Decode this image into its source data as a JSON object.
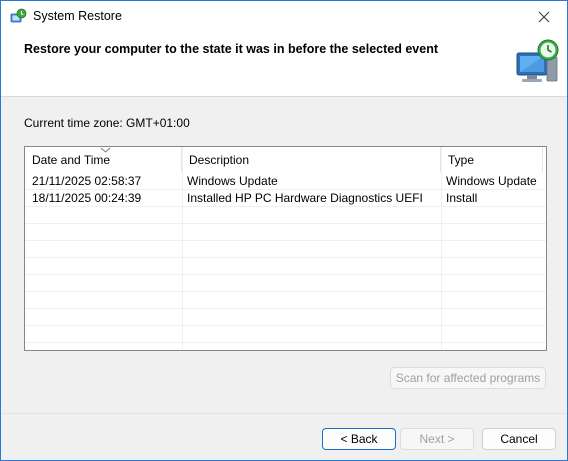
{
  "window": {
    "title": "System Restore",
    "icon": "system-restore-icon"
  },
  "header": {
    "heading": "Restore your computer to the state it was in before the selected event",
    "icon": "computer-restore-clock-icon"
  },
  "timezone": {
    "label": "Current time zone: GMT+01:00"
  },
  "restore_points": {
    "columns": [
      "Date and Time",
      "Description",
      "Type"
    ],
    "sorted_column": "Date and Time",
    "rows": [
      {
        "date": "21/11/2025 02:58:37",
        "description": "Windows Update",
        "type": "Windows Update"
      },
      {
        "date": "18/11/2025 00:24:39",
        "description": "Installed HP PC Hardware Diagnostics UEFI",
        "type": "Install"
      }
    ]
  },
  "buttons": {
    "scan": "Scan for affected programs",
    "back": "< Back",
    "next": "Next >",
    "cancel": "Cancel"
  },
  "colors": {
    "accent": "#1a6fc9",
    "window_border": "#2b78d4",
    "disabled_text": "#a0a0a0"
  }
}
